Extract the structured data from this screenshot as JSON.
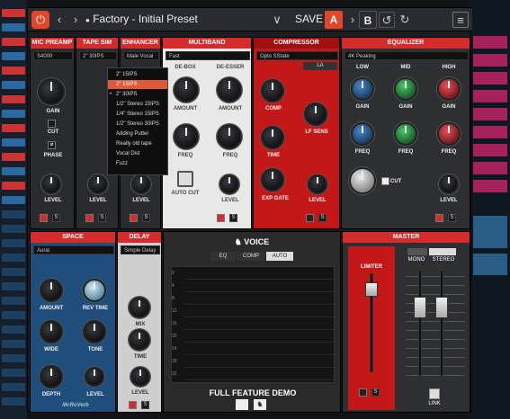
{
  "topbar": {
    "preset_name": "Factory - Initial Preset",
    "save_label": "SAVE",
    "a_label": "A",
    "b_label": "B",
    "accent": "#e0472a"
  },
  "modules": {
    "mic_preamp": {
      "title": "MIC PREAMP",
      "select": "S4000",
      "gain": "GAIN",
      "cut": "CUT",
      "phase": "PHASE",
      "level": "LEVEL",
      "s": "S"
    },
    "tape_sim": {
      "title": "TAPE SIM",
      "select": "2\" 30IPS",
      "level": "LEVEL",
      "s": "S"
    },
    "enhancer": {
      "title": "ENHANCER",
      "select": "Male Vocal",
      "level": "LEVEL",
      "s": "S"
    },
    "multiband": {
      "title": "MULTIBAND",
      "select": "Fast",
      "de_box": "DE-BOX",
      "de_esser": "DE-ESSER",
      "amount1": "AMOUNT",
      "amount2": "AMOUNT",
      "freq1": "FREQ",
      "freq2": "FREQ",
      "auto_cut": "AUTO CUT",
      "level": "LEVEL",
      "s": "S"
    },
    "compressor": {
      "title": "COMPRESSOR",
      "select": "Opto SState",
      "la": "LA",
      "comp": "COMP",
      "time": "TIME",
      "lf_sens": "LF SENS",
      "exp_gate": "EXP GATE",
      "level": "LEVEL",
      "s": "S"
    },
    "equalizer": {
      "title": "EQUALIZER",
      "select": "4K Peaking",
      "low": "LOW",
      "mid": "MID",
      "high": "HIGH",
      "gain1": "GAIN",
      "gain2": "GAIN",
      "gain3": "GAIN",
      "freq1": "FREQ",
      "freq2": "FREQ",
      "freq3": "FREQ",
      "cut": "CUT",
      "level": "LEVEL",
      "s": "S"
    },
    "space": {
      "title": "SPACE",
      "select": "Aural",
      "amount": "AMOUNT",
      "rev_time": "REV TIME",
      "wide": "WIDE",
      "tone": "TONE",
      "depth": "DEPTH",
      "level": "LEVEL",
      "brand": "McRoVerb"
    },
    "delay": {
      "title": "DELAY",
      "select": "Simple Delay",
      "mix": "MIX",
      "time": "TIME",
      "level": "LEVEL",
      "s": "S"
    },
    "voice": {
      "title": "VOICE",
      "tabs": [
        "EQ",
        "COMP",
        "AUTO"
      ],
      "active_tab": "AUTO",
      "demo": "FULL FEATURE DEMO",
      "scale": [
        "0",
        "4",
        "8",
        "12",
        "16",
        "20",
        "24",
        "28",
        "32"
      ]
    },
    "master": {
      "title": "MASTER",
      "limiter": "LIMITER",
      "mono": "MONO",
      "stereo": "STEREO",
      "link": "LINK",
      "s": "S"
    }
  },
  "tape_dropdown": {
    "items": [
      "2\" 15IPS",
      "2\" 15IPS",
      "2\" 30IPS",
      "1/2\" Stereo 15IPS",
      "1/4\" Stereo 15IPS",
      "1/2\" Stereo 30IPS",
      "Adding Putter",
      "Really old tape",
      "Vocal Dist",
      "Fuzz"
    ],
    "selected_index": 1,
    "current_index": 2
  }
}
